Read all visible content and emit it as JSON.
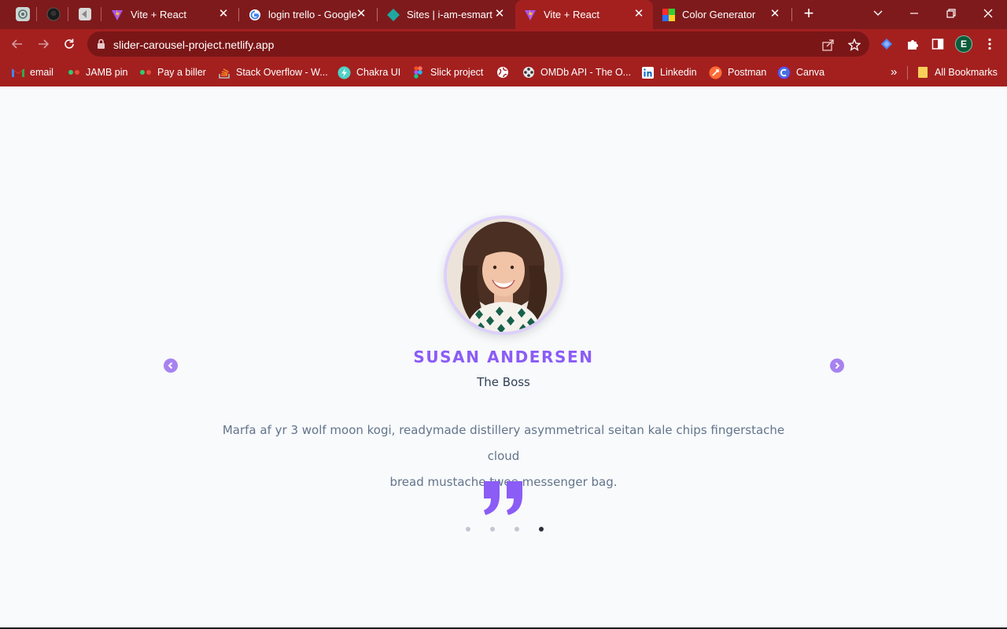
{
  "browser": {
    "pinned_tabs": [
      {
        "icon": "chatgpt-icon"
      },
      {
        "icon": "github-icon"
      },
      {
        "icon": "app-icon"
      }
    ],
    "tabs": [
      {
        "title": "Vite + React",
        "icon": "vite-icon",
        "active": false
      },
      {
        "title": "login trello - Google",
        "icon": "google-icon",
        "active": false
      },
      {
        "title": "Sites | i-am-esmart |",
        "icon": "netlify-icon",
        "active": false
      },
      {
        "title": "Vite + React",
        "icon": "vite-icon",
        "active": true
      },
      {
        "title": "Color Generator",
        "icon": "color-grid-icon",
        "active": false
      }
    ],
    "url": "slider-carousel-project.netlify.app",
    "profile_initial": "E",
    "bookmarks": [
      {
        "label": "email",
        "icon": "gmail-icon"
      },
      {
        "label": "JAMB pin",
        "icon": "dots-icon"
      },
      {
        "label": "Pay a biller",
        "icon": "dots-icon"
      },
      {
        "label": "Stack Overflow - W...",
        "icon": "stackoverflow-icon"
      },
      {
        "label": "Chakra UI",
        "icon": "chakra-icon"
      },
      {
        "label": "Slick project",
        "icon": "figma-icon"
      },
      {
        "label": "",
        "icon": "globe-icon"
      },
      {
        "label": "OMDb API - The O...",
        "icon": "film-icon"
      },
      {
        "label": "Linkedin",
        "icon": "linkedin-icon"
      },
      {
        "label": "Postman",
        "icon": "postman-icon"
      },
      {
        "label": "Canva",
        "icon": "canva-icon"
      }
    ],
    "more_bookmarks": "»",
    "all_bookmarks": "All Bookmarks"
  },
  "slider": {
    "name": "SUSAN ANDERSEN",
    "job": "The Boss",
    "text_line1": "Marfa af yr 3 wolf moon kogi, readymade distillery asymmetrical seitan kale chips fingerstache cloud",
    "text_line2": "bread mustache twee messenger bag.",
    "slide_count": 4,
    "active_slide": 4,
    "accent": "#8b5cf6"
  }
}
